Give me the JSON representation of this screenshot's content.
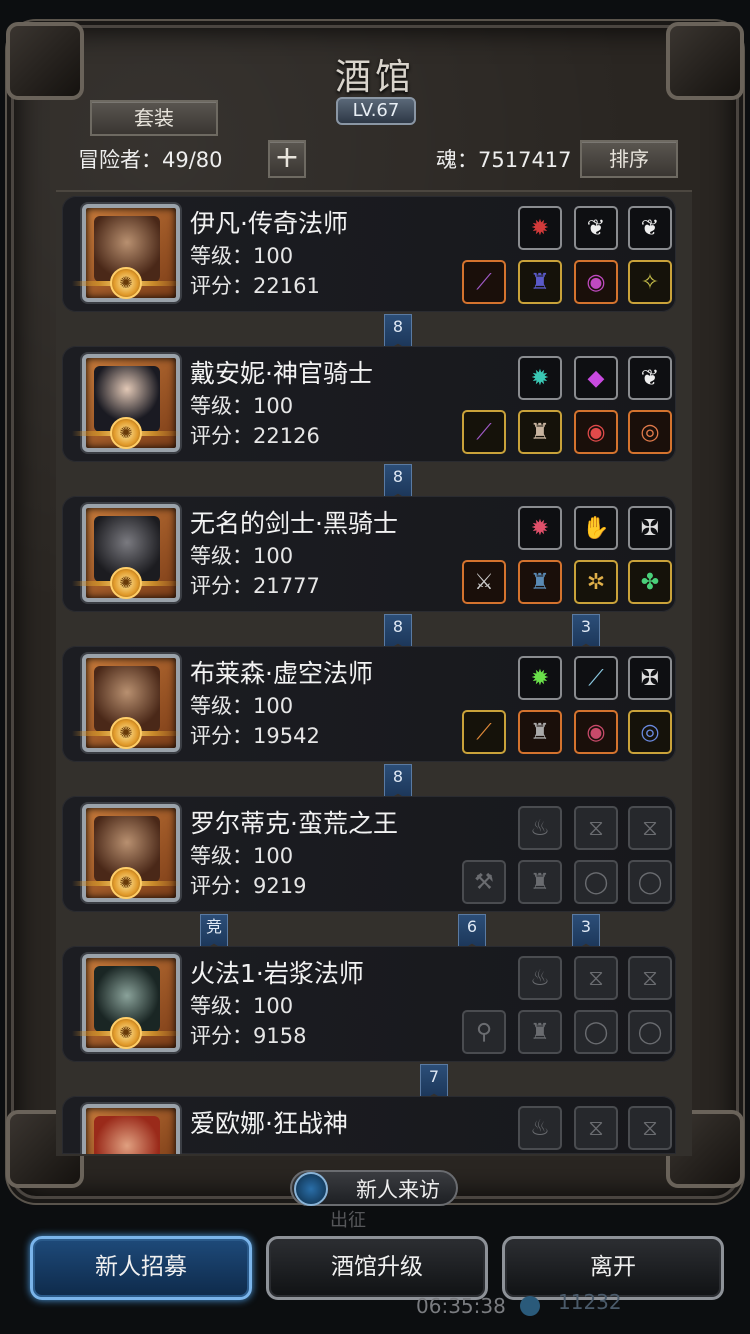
{
  "title": "酒馆",
  "level": "LV.67",
  "set_button": "套装",
  "adventurers_label": "冒险者：49/80",
  "add_symbol": "+",
  "soul_label": "魂：7517417",
  "sort_button": "排序",
  "heroes": [
    {
      "name": "伊凡·传奇法师",
      "level": "等级：100",
      "score": "评分：22161"
    },
    {
      "name": "戴安妮·神官骑士",
      "level": "等级：100",
      "score": "评分：22126"
    },
    {
      "name": "无名的剑士·黑骑士",
      "level": "等级：100",
      "score": "评分：21777"
    },
    {
      "name": "布莱森·虚空法师",
      "level": "等级：100",
      "score": "评分：19542"
    },
    {
      "name": "罗尔蒂克·蛮荒之王",
      "level": "等级：100",
      "score": "评分：9219"
    },
    {
      "name": "火法1·岩浆法师",
      "level": "等级：100",
      "score": "评分：9158"
    },
    {
      "name": "爱欧娜·狂战神",
      "level": "",
      "score": ""
    }
  ],
  "connectors": [
    "8",
    "8",
    "8",
    "3",
    "8",
    "竞",
    "6",
    "3",
    "7"
  ],
  "visit_button": "新人来访",
  "go_text": "出征",
  "bottom_buttons": {
    "recruit": "新人招募",
    "upgrade": "酒馆升级",
    "leave": "离开"
  },
  "clock": "06:35:38",
  "clock_extra": "11232"
}
